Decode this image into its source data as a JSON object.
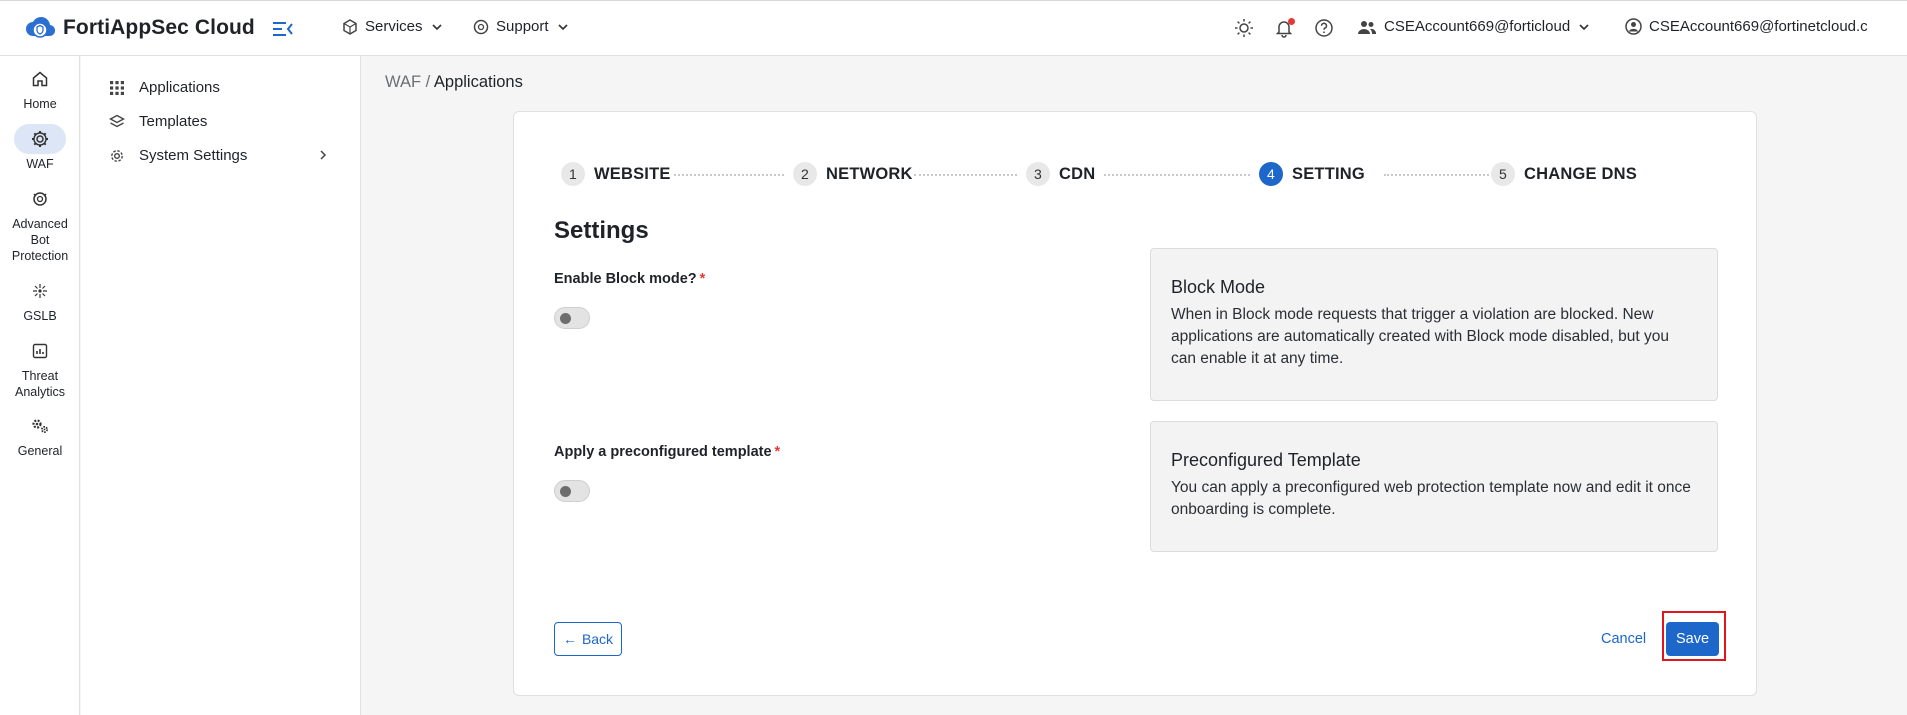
{
  "header": {
    "app_title": "FortiAppSec Cloud",
    "services_label": "Services",
    "support_label": "Support",
    "account_label": "CSEAccount669@forticloud",
    "user_label": "CSEAccount669@fortinetcloud.c"
  },
  "rail": {
    "items": [
      {
        "label": "Home"
      },
      {
        "label": "WAF"
      },
      {
        "label": "Advanced Bot Protection"
      },
      {
        "label": "GSLB"
      },
      {
        "label": "Threat Analytics"
      },
      {
        "label": "General"
      }
    ]
  },
  "sidebar": {
    "items": [
      {
        "label": "Applications"
      },
      {
        "label": "Templates"
      },
      {
        "label": "System Settings"
      }
    ]
  },
  "breadcrumb": {
    "parent": "WAF",
    "separator": " / ",
    "current": "Applications"
  },
  "wizard": {
    "steps": [
      {
        "num": "1",
        "label": "WEBSITE"
      },
      {
        "num": "2",
        "label": "NETWORK"
      },
      {
        "num": "3",
        "label": "CDN"
      },
      {
        "num": "4",
        "label": "SETTING"
      },
      {
        "num": "5",
        "label": "CHANGE DNS"
      }
    ],
    "active_step": 4
  },
  "settings": {
    "title": "Settings",
    "block_mode_label": "Enable Block mode?",
    "template_label": "Apply a preconfigured template",
    "required_mark": "*",
    "block_mode_enabled": false,
    "template_enabled": false,
    "block_info_title": "Block Mode",
    "block_info_text": "When in Block mode requests that trigger a violation are blocked. New applications are automatically created with Block mode disabled, but you can enable it at any time.",
    "template_info_title": "Preconfigured Template",
    "template_info_text": "You can apply a preconfigured web protection template now and edit it once onboarding is complete."
  },
  "actions": {
    "back_label": "Back",
    "cancel_label": "Cancel",
    "save_label": "Save"
  },
  "colors": {
    "accent": "#1c67c9",
    "highlight": "#e0161f",
    "notification": "#e53935"
  }
}
